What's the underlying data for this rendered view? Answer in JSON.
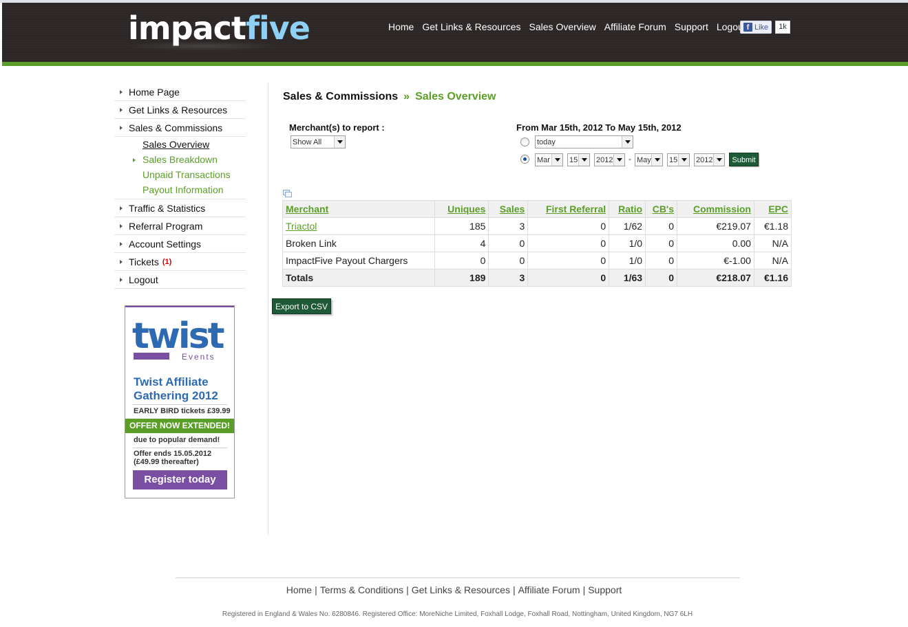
{
  "header": {
    "logo_part1": "impact",
    "logo_part2": "five",
    "nav": [
      "Home",
      "Get Links & Resources",
      "Sales Overview",
      "Affiliate Forum",
      "Support",
      "Logout"
    ],
    "fb_like": "Like",
    "fb_count": "1k"
  },
  "sidebar": {
    "items": [
      {
        "label": "Home Page"
      },
      {
        "label": "Get Links & Resources"
      },
      {
        "label": "Sales & Commissions"
      },
      {
        "label": "Traffic & Statistics"
      },
      {
        "label": "Referral Program"
      },
      {
        "label": "Account Settings"
      },
      {
        "label": "Tickets",
        "badge": "(1)"
      },
      {
        "label": "Logout"
      }
    ],
    "subitems": [
      {
        "label": "Sales Overview"
      },
      {
        "label": "Sales Breakdown"
      },
      {
        "label": "Unpaid Transactions"
      },
      {
        "label": "Payout Information"
      }
    ]
  },
  "ad": {
    "logo": "twist",
    "events": "Events",
    "title": "Twist Affiliate Gathering 2012",
    "early": "EARLY BIRD tickets £39.99",
    "offer": "OFFER NOW EXTENDED!",
    "due": "due to popular demand!",
    "ends_line1": "Offer ends 15.05.2012",
    "ends_line2": "(£49.99 thereafter)",
    "button": "Register today"
  },
  "main": {
    "breadcrumb_parent": "Sales & Commissions",
    "breadcrumb_sep": "»",
    "breadcrumb_current": "Sales Overview",
    "merchant_label": "Merchant(s) to report :",
    "merchant_value": "Show All",
    "date_label": "From Mar 15th, 2012 To May 15th, 2012",
    "preset_value": "today",
    "from_month": "Mar",
    "from_day": "15",
    "from_year": "2012",
    "dash": "-",
    "to_month": "May",
    "to_day": "15",
    "to_year": "2012",
    "submit": "Submit",
    "export": "Export to CSV"
  },
  "table": {
    "headers": [
      "Merchant",
      "Uniques",
      "Sales",
      "First Referral",
      "Ratio",
      "CB's",
      "Commission",
      "EPC"
    ],
    "rows": [
      [
        "Triactol",
        "185",
        "3",
        "0",
        "1/62",
        "0",
        "€219.07",
        "€1.18"
      ],
      [
        "Broken Link",
        "4",
        "0",
        "0",
        "1/0",
        "0",
        "0.00",
        "N/A"
      ],
      [
        "ImpactFive Payout Chargers",
        "0",
        "0",
        "0",
        "1/0",
        "0",
        "€-1.00",
        "N/A"
      ]
    ],
    "totals": [
      "Totals",
      "189",
      "3",
      "0",
      "1/63",
      "0",
      "€218.07",
      "€1.16"
    ]
  },
  "footer": {
    "links": [
      "Home",
      "Terms & Conditions",
      "Get Links & Resources",
      "Affiliate Forum",
      "Support"
    ],
    "registered": "Registered in England & Wales No. 6280846. Registered Office: MoreNiche Limited, Foxhall Lodge, Foxhall Road, Nottingham, United Kingdom, NG7 6LH"
  },
  "colors": {
    "header_bg": "#2c2726",
    "accent_green": "#5b9e27",
    "button_dark_green": "#1f5a38",
    "ad_purple": "#7a4ea3",
    "ad_blue": "#2e6ab1"
  }
}
